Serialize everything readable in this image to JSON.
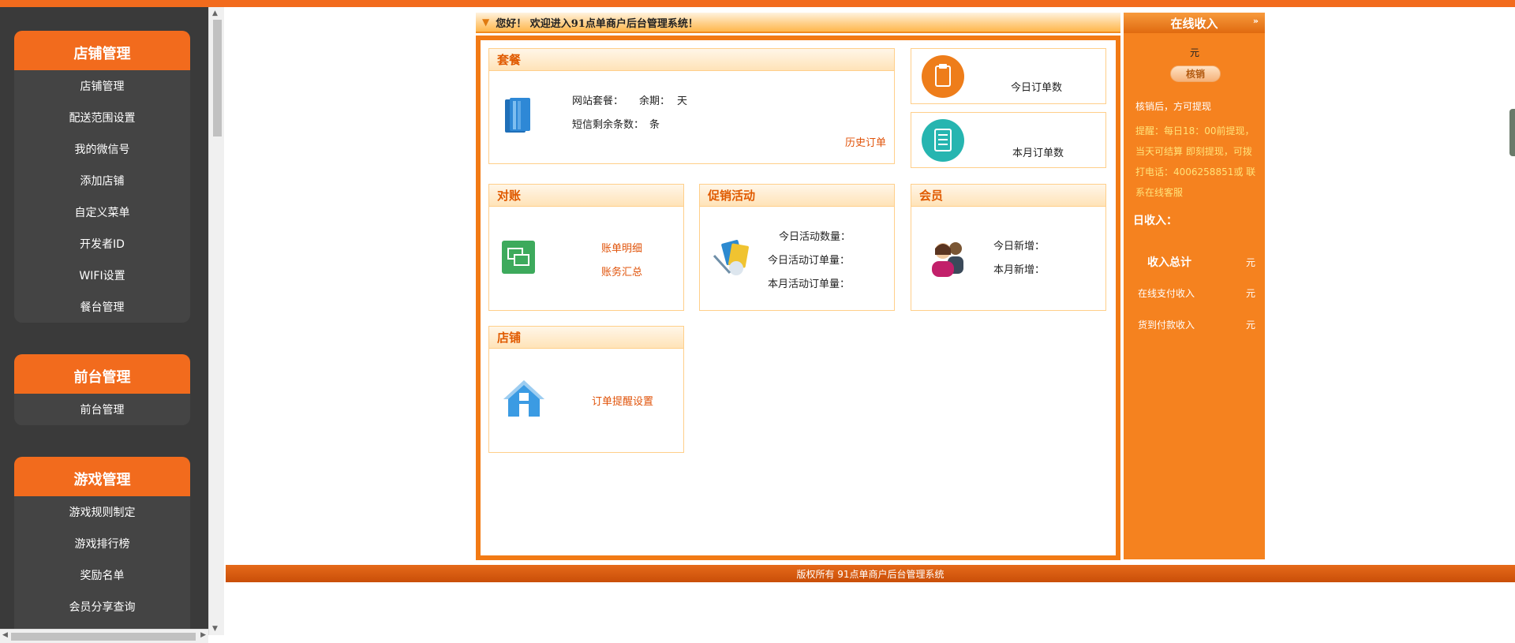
{
  "sidebar": {
    "groups": [
      {
        "title": "店铺管理",
        "items": [
          "店铺管理",
          "配送范围设置",
          "我的微信号",
          "添加店铺",
          "自定义菜单",
          "开发者ID",
          "WIFI设置",
          "餐台管理"
        ]
      },
      {
        "title": "前台管理",
        "items": [
          "前台管理"
        ]
      },
      {
        "title": "游戏管理",
        "items": [
          "游戏规则制定",
          "游戏排行榜",
          "奖励名单",
          "会员分享查询"
        ]
      }
    ]
  },
  "welcome": "您好！ 欢迎进入91点单商户后台管理系统！",
  "package": {
    "title": "套餐",
    "site_package": "网站套餐：",
    "remaining": "余期：",
    "days_unit": "天",
    "sms_remaining": "短信剩余条数：",
    "sms_unit": "条",
    "history_link": "历史订单"
  },
  "stats": {
    "today_orders": "今日订单数",
    "month_orders": "本月订单数"
  },
  "reconcile": {
    "title": "对账",
    "detail_link": "账单明细",
    "summary_link": "账务汇总"
  },
  "promo": {
    "title": "促销活动",
    "today_count": "今日活动数量：",
    "today_orders": "今日活动订单量：",
    "month_orders": "本月活动订单量："
  },
  "member": {
    "title": "会员",
    "today_new": "今日新增：",
    "month_new": "本月新增："
  },
  "store": {
    "title": "店铺",
    "reminder_link": "订单提醒设置"
  },
  "income": {
    "title": "在线收入",
    "currency": "元",
    "verify_button": "核销",
    "verify_note": "核销后，方可提现",
    "reminder": "提醒：每日18：00前提现，当天可结算 即刻提现，可拨打电话：4006258851或 联系在线客服",
    "daily_label": "日收入：",
    "total_label": "收入总计",
    "total_unit": "元",
    "online_label": "在线支付收入",
    "online_unit": "元",
    "cod_label": "货到付款收入",
    "cod_unit": "元"
  },
  "footer": "版权所有 91点单商户后台管理系统",
  "colors": {
    "accent": "#f26b1d",
    "sidebar": "#3a3a3a",
    "link": "#e0530a"
  }
}
